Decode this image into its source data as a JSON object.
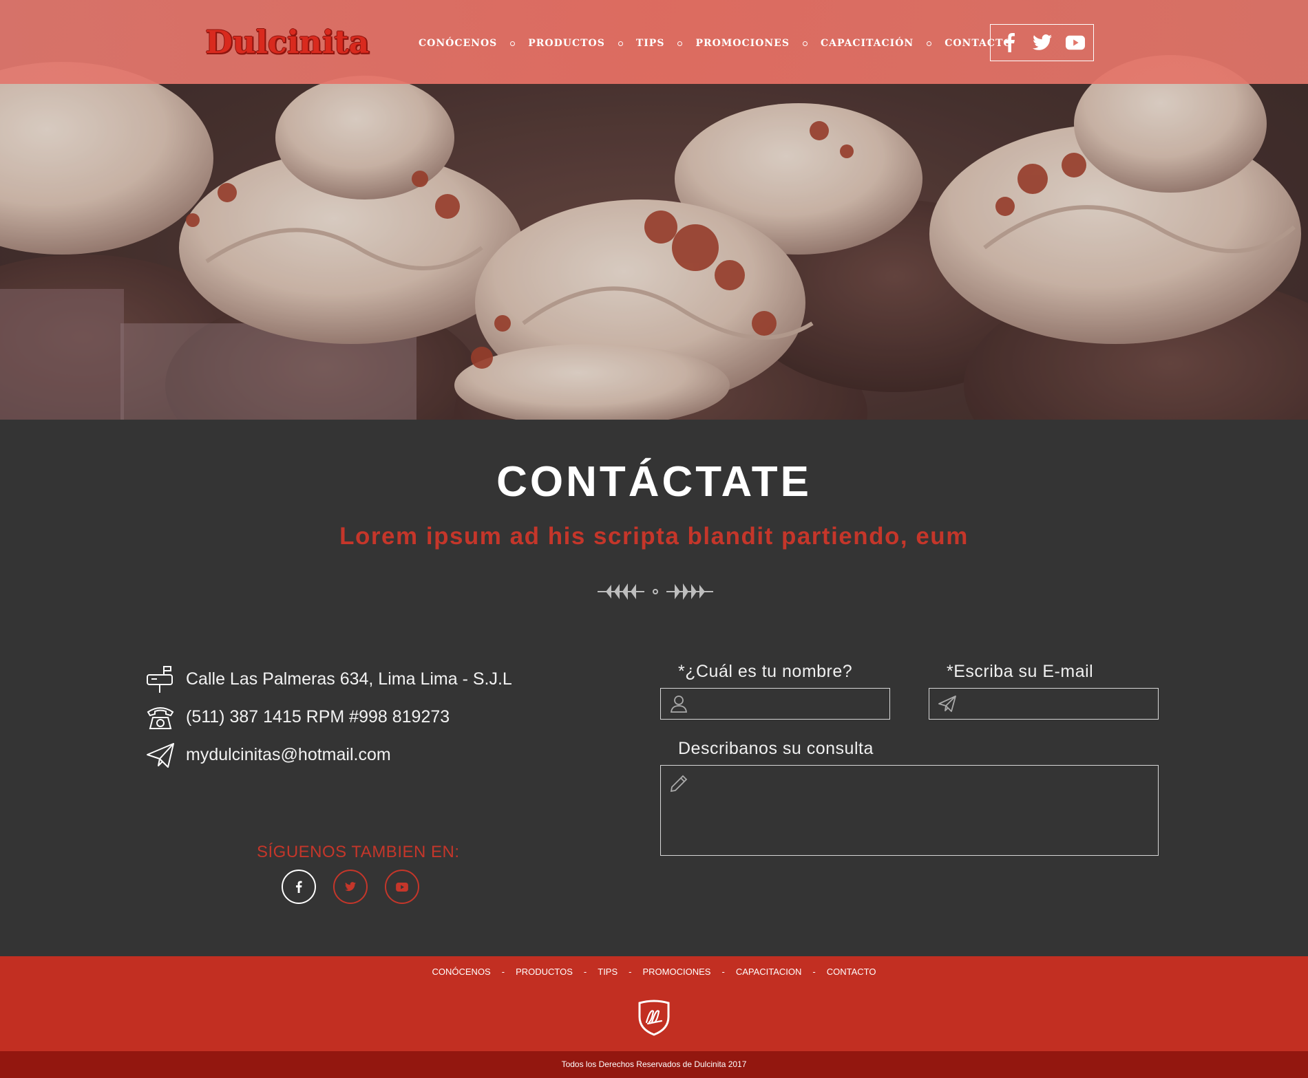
{
  "brand": {
    "logo_text": "Dulcinita",
    "accent": "#c5362a",
    "dark_bg": "#343434",
    "footer_bg": "#c22f22",
    "copy_bg": "#93170f"
  },
  "header": {
    "nav": [
      {
        "label": "CONÓCENOS"
      },
      {
        "label": "PRODUCTOS"
      },
      {
        "label": "TIPS"
      },
      {
        "label": "PROMOCIONES"
      },
      {
        "label": "CAPACITACIÓN"
      },
      {
        "label": "CONTACTO"
      }
    ],
    "social_icons": [
      "facebook-icon",
      "twitter-icon",
      "youtube-icon"
    ]
  },
  "contact": {
    "title": "CONTÁCTATE",
    "subtitle": "Lorem ipsum ad his scripta blandit partiendo, eum",
    "info": [
      {
        "icon": "mailbox-icon",
        "text": "Calle Las Palmeras 634, Lima Lima - S.J.L"
      },
      {
        "icon": "telephone-icon",
        "text": "(511) 387 1415 RPM #998 819273"
      },
      {
        "icon": "paper-plane-icon",
        "text": "mydulcinitas@hotmail.com"
      }
    ],
    "follow_label": "SÍGUENOS TAMBIEN EN:",
    "form": {
      "name_label": "*¿Cuál es tu nombre?",
      "name_value": "",
      "email_label": "*Escriba su E-mail",
      "email_value": "",
      "message_label": "Describanos su consulta",
      "message_value": ""
    }
  },
  "footer": {
    "nav": [
      "CONÓCENOS",
      "PRODUCTOS",
      "TIPS",
      "PROMOCIONES",
      "CAPACITACION",
      "CONTACTO"
    ],
    "separator": "-",
    "copyright": "Todos los Derechos Reservados de Dulcinita 2017"
  }
}
